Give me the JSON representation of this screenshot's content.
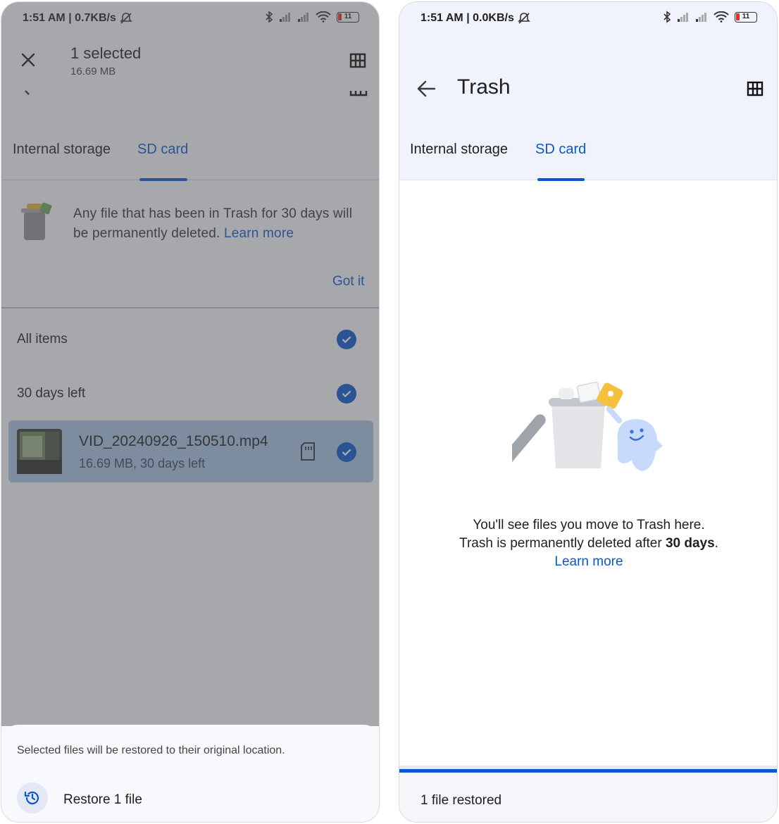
{
  "left": {
    "status": {
      "time": "1:51 AM",
      "speed": "0.7KB/s",
      "battery": "11"
    },
    "header": {
      "title": "1 selected",
      "subtitle": "16.69 MB"
    },
    "tabs": [
      {
        "label": "Internal storage"
      },
      {
        "label": "SD card"
      }
    ],
    "banner": {
      "text": "Any file that has been in Trash for 30 days will be permanently deleted.",
      "link": "Learn more",
      "action": "Got it"
    },
    "sections": [
      {
        "label": "All items"
      },
      {
        "label": "30 days left"
      }
    ],
    "file": {
      "name": "VID_20240926_150510.mp4",
      "meta": "16.69 MB, 30 days left"
    },
    "sheet": {
      "message": "Selected files will be restored to their original location.",
      "action": "Restore 1 file"
    },
    "colors": {
      "accent": "#0b57d0",
      "selected_row": "#a7c3e3"
    }
  },
  "right": {
    "status": {
      "time": "1:51 AM",
      "speed": "0.0KB/s",
      "battery": "11"
    },
    "header": {
      "title": "Trash"
    },
    "tabs": [
      {
        "label": "Internal storage"
      },
      {
        "label": "SD card"
      }
    ],
    "empty": {
      "line1": "You'll see files you move to Trash here.",
      "line2_prefix": "Trash is permanently deleted after ",
      "line2_bold": "30 days",
      "line2_suffix": ".",
      "link": "Learn more"
    },
    "snackbar": {
      "text": "1 file restored"
    }
  }
}
